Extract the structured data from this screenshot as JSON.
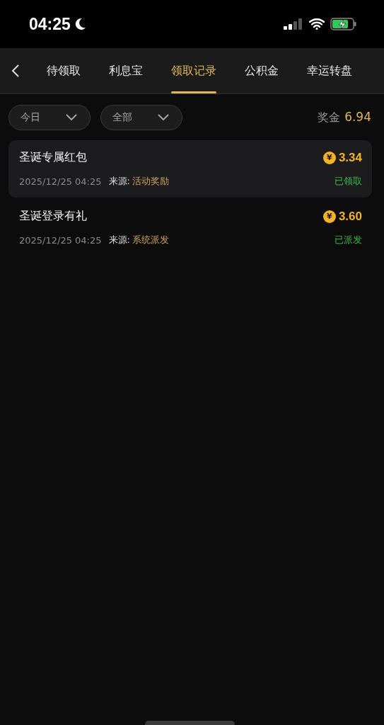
{
  "status_bar": {
    "time": "04:25"
  },
  "tabs": [
    {
      "label": "待领取",
      "selected": false
    },
    {
      "label": "利息宝",
      "selected": false
    },
    {
      "label": "领取记录",
      "selected": true
    },
    {
      "label": "公积金",
      "selected": false
    },
    {
      "label": "幸运转盘",
      "selected": false
    }
  ],
  "filters": [
    {
      "value": "今日"
    },
    {
      "value": "全部"
    }
  ],
  "bonus": {
    "label": "奖金",
    "amount": "6.94"
  },
  "records": [
    {
      "title": "圣诞专属红包",
      "coin_symbol": "¥",
      "amount": "3.34",
      "time": "2025/12/25 04:25",
      "source_label": "来源:",
      "source": "活动奖励",
      "status": "已领取",
      "selected": true
    },
    {
      "title": "圣诞登录有礼",
      "coin_symbol": "¥",
      "amount": "3.60",
      "time": "2025/12/25 04:25",
      "source_label": "来源:",
      "source": "系统派发",
      "status": "已派发",
      "selected": false
    }
  ]
}
